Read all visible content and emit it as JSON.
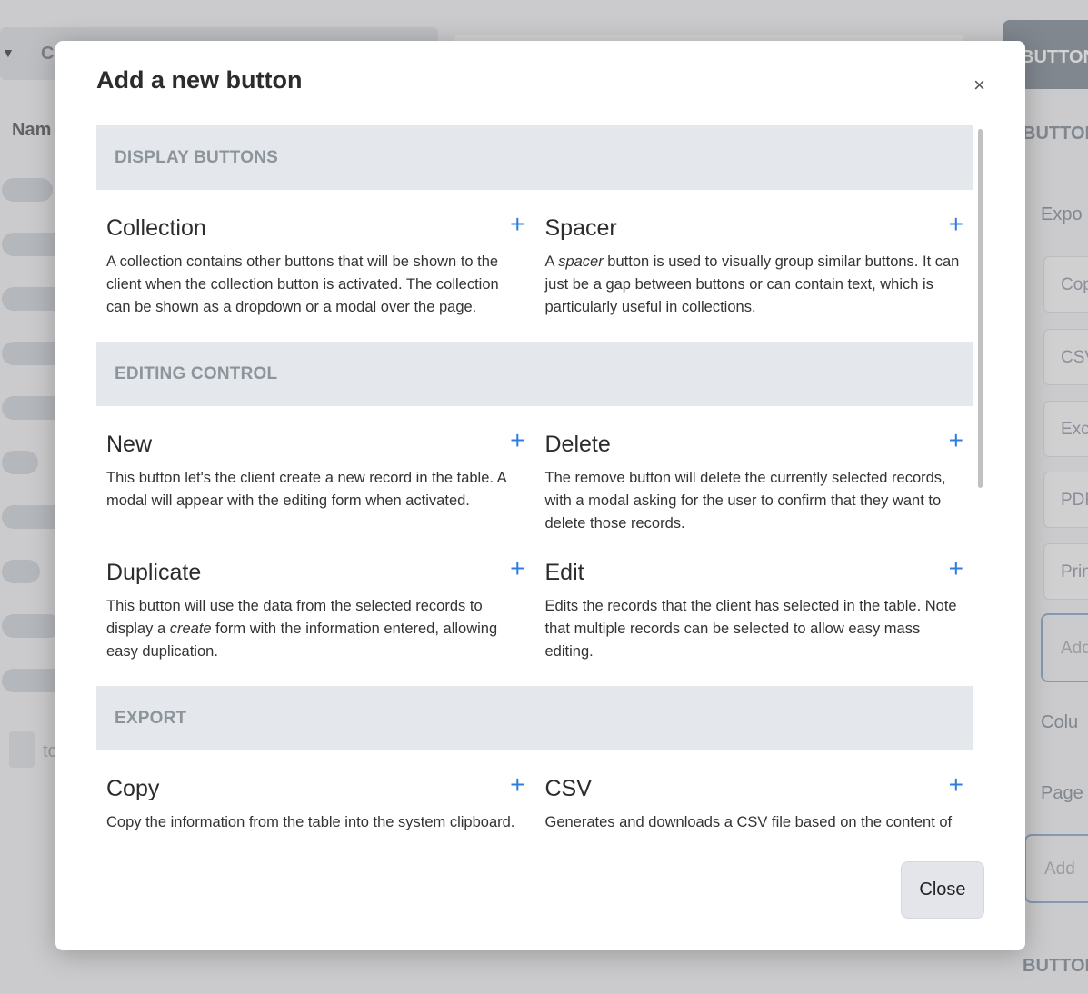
{
  "background": {
    "top_label": "C",
    "name_header": "Nam",
    "top_button": "BUTTON",
    "right_labels": [
      "BUTTON",
      "Expo",
      "Colu",
      "Page",
      "BUTTON"
    ],
    "right_items": [
      "Cop",
      "CSV",
      "Exc",
      "PDF",
      "Prin"
    ],
    "right_add": [
      "Add",
      "Add"
    ],
    "footer_text": "to"
  },
  "modal": {
    "title": "Add a new button",
    "close_icon": "×",
    "close_button": "Close",
    "sections": [
      {
        "header": "DISPLAY BUTTONS",
        "items": [
          {
            "title": "Collection",
            "desc": "A collection contains other buttons that will be shown to the client when the collection button is activated. The collection can be shown as a dropdown or a modal over the page."
          },
          {
            "title": "Spacer",
            "desc_pre": "A ",
            "desc_em": "spacer",
            "desc_post": " button is used to visually group similar buttons. It can just be a gap between buttons or can contain text, which is particularly useful in collections."
          }
        ]
      },
      {
        "header": "EDITING CONTROL",
        "items": [
          {
            "title": "New",
            "desc": "This button let's the client create a new record in the table. A modal will appear with the editing form when activated."
          },
          {
            "title": "Delete",
            "desc": "The remove button will delete the currently selected records, with a modal asking for the user to confirm that they want to delete those records."
          },
          {
            "title": "Duplicate",
            "desc_pre": "This button will use the data from the selected records to display a ",
            "desc_em": "create",
            "desc_post": " form with the information entered, allowing easy duplication."
          },
          {
            "title": "Edit",
            "desc": "Edits the records that the client has selected in the table. Note that multiple records can be selected to allow easy mass editing."
          }
        ]
      },
      {
        "header": "EXPORT",
        "items": [
          {
            "title": "Copy",
            "desc": "Copy the information from the table into the system clipboard."
          },
          {
            "title": "CSV",
            "desc": "Generates and downloads a CSV file based on the content of the table."
          }
        ]
      }
    ],
    "add_icon": "+"
  }
}
